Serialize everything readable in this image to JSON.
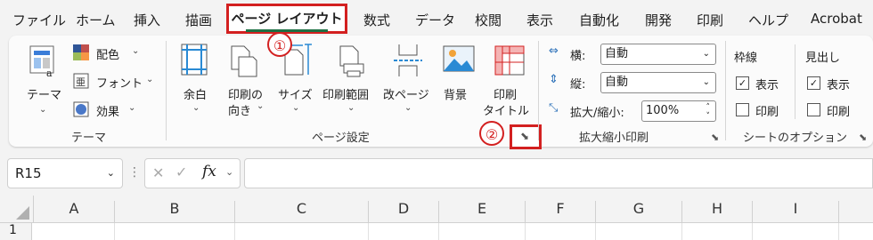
{
  "menu": {
    "tabs": [
      "ファイル",
      "ホーム",
      "挿入",
      "描画",
      "数式",
      "データ",
      "校閲",
      "表示",
      "自動化",
      "開発",
      "印刷",
      "ヘルプ",
      "Acrobat"
    ],
    "active_tab": "ページ レイアウト"
  },
  "callouts": {
    "one": "①",
    "two": "②"
  },
  "ribbon": {
    "themes": {
      "theme_label": "テーマ",
      "colors_label": "配色",
      "fonts_label": "フォント",
      "effects_label": "効果",
      "group_label": "テーマ"
    },
    "page_setup": {
      "margins_label": "余白",
      "orientation_label_1": "印刷の",
      "orientation_label_2": "向き",
      "size_label": "サイズ",
      "print_area_label": "印刷範囲",
      "breaks_label": "改ページ",
      "background_label": "背景",
      "print_titles_label_1": "印刷",
      "print_titles_label_2": "タイトル",
      "group_label": "ページ設定"
    },
    "scale_to_fit": {
      "width_label": "横:",
      "width_value": "自動",
      "height_label": "縦:",
      "height_value": "自動",
      "scale_label": "拡大/縮小:",
      "scale_value": "100%",
      "group_label": "拡大縮小印刷"
    },
    "sheet_options": {
      "gridlines_label": "枠線",
      "headings_label": "見出し",
      "view_label": "表示",
      "print_label": "印刷",
      "gridlines_view_checked": true,
      "gridlines_print_checked": false,
      "headings_view_checked": true,
      "headings_print_checked": false,
      "group_label": "シートのオプション"
    }
  },
  "formula_bar": {
    "name_box": "R15",
    "fx": "fx",
    "formula": ""
  },
  "grid": {
    "columns": [
      "A",
      "B",
      "C",
      "D",
      "E",
      "F",
      "G",
      "H",
      "I"
    ],
    "rows": [
      "1"
    ]
  },
  "colors": {
    "highlight_red": "#d32020",
    "excel_green": "#1e7145"
  }
}
